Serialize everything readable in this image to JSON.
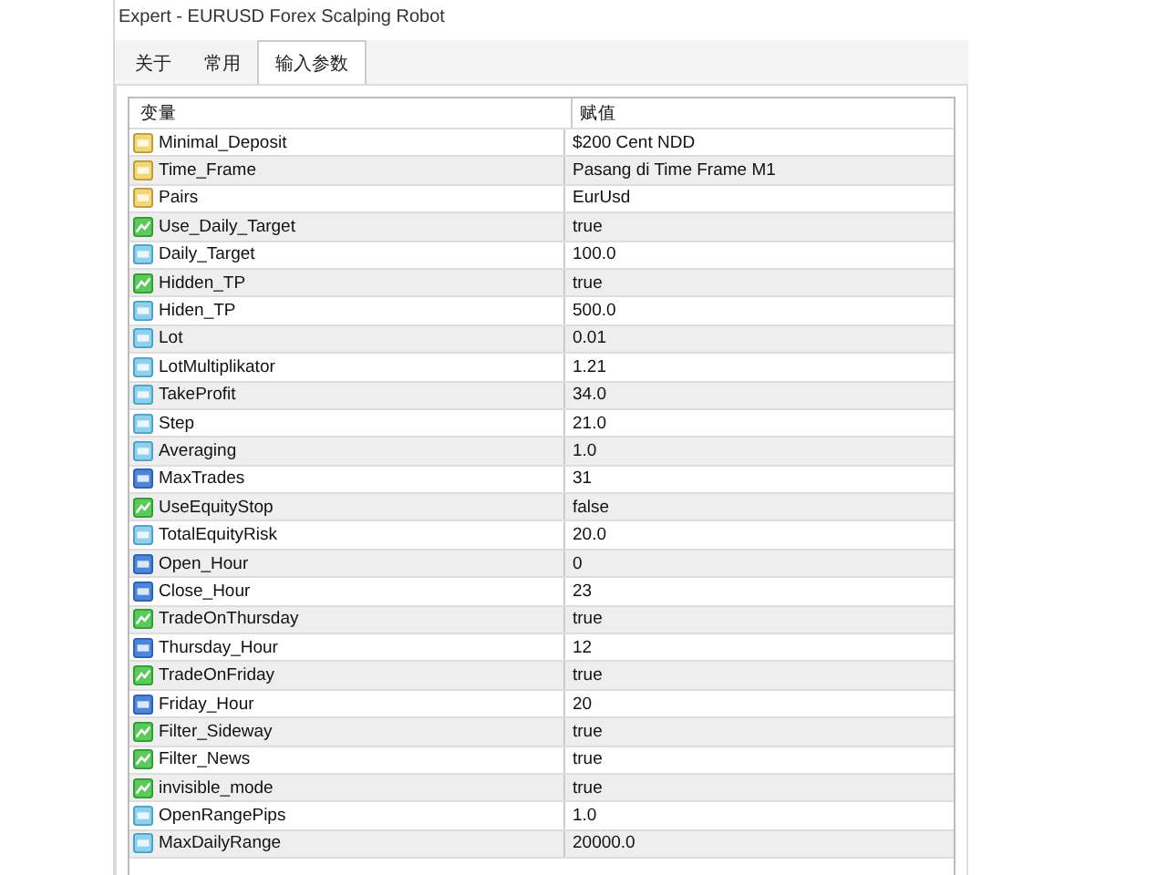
{
  "window": {
    "title": "Expert - EURUSD Forex Scalping Robot"
  },
  "tabs": [
    {
      "label": "关于",
      "selected": false
    },
    {
      "label": "常用",
      "selected": false
    },
    {
      "label": "输入参数",
      "selected": true
    }
  ],
  "table": {
    "columns": [
      "变量",
      "赋值"
    ],
    "rows": [
      {
        "kind": "string",
        "name": "Minimal_Deposit",
        "value": "$200 Cent NDD"
      },
      {
        "kind": "string",
        "name": "Time_Frame",
        "value": "Pasang di Time Frame M1"
      },
      {
        "kind": "string",
        "name": "Pairs",
        "value": "EurUsd"
      },
      {
        "kind": "bool",
        "name": "Use_Daily_Target",
        "value": "true"
      },
      {
        "kind": "double",
        "name": "Daily_Target",
        "value": "100.0"
      },
      {
        "kind": "bool",
        "name": "Hidden_TP",
        "value": "true"
      },
      {
        "kind": "double",
        "name": "Hiden_TP",
        "value": "500.0"
      },
      {
        "kind": "double",
        "name": "Lot",
        "value": "0.01"
      },
      {
        "kind": "double",
        "name": "LotMultiplikator",
        "value": "1.21"
      },
      {
        "kind": "double",
        "name": "TakeProfit",
        "value": "34.0"
      },
      {
        "kind": "double",
        "name": "Step",
        "value": "21.0"
      },
      {
        "kind": "double",
        "name": "Averaging",
        "value": "1.0"
      },
      {
        "kind": "int",
        "name": "MaxTrades",
        "value": "31"
      },
      {
        "kind": "bool",
        "name": "UseEquityStop",
        "value": "false"
      },
      {
        "kind": "double",
        "name": "TotalEquityRisk",
        "value": "20.0"
      },
      {
        "kind": "int",
        "name": "Open_Hour",
        "value": "0"
      },
      {
        "kind": "int",
        "name": "Close_Hour",
        "value": "23"
      },
      {
        "kind": "bool",
        "name": "TradeOnThursday",
        "value": "true"
      },
      {
        "kind": "int",
        "name": "Thursday_Hour",
        "value": "12"
      },
      {
        "kind": "bool",
        "name": "TradeOnFriday",
        "value": "true"
      },
      {
        "kind": "int",
        "name": "Friday_Hour",
        "value": "20"
      },
      {
        "kind": "bool",
        "name": "Filter_Sideway",
        "value": "true"
      },
      {
        "kind": "bool",
        "name": "Filter_News",
        "value": "true"
      },
      {
        "kind": "bool",
        "name": "invisible_mode",
        "value": "true"
      },
      {
        "kind": "double",
        "name": "OpenRangePips",
        "value": "1.0"
      },
      {
        "kind": "double",
        "name": "MaxDailyRange",
        "value": "20000.0"
      }
    ]
  }
}
